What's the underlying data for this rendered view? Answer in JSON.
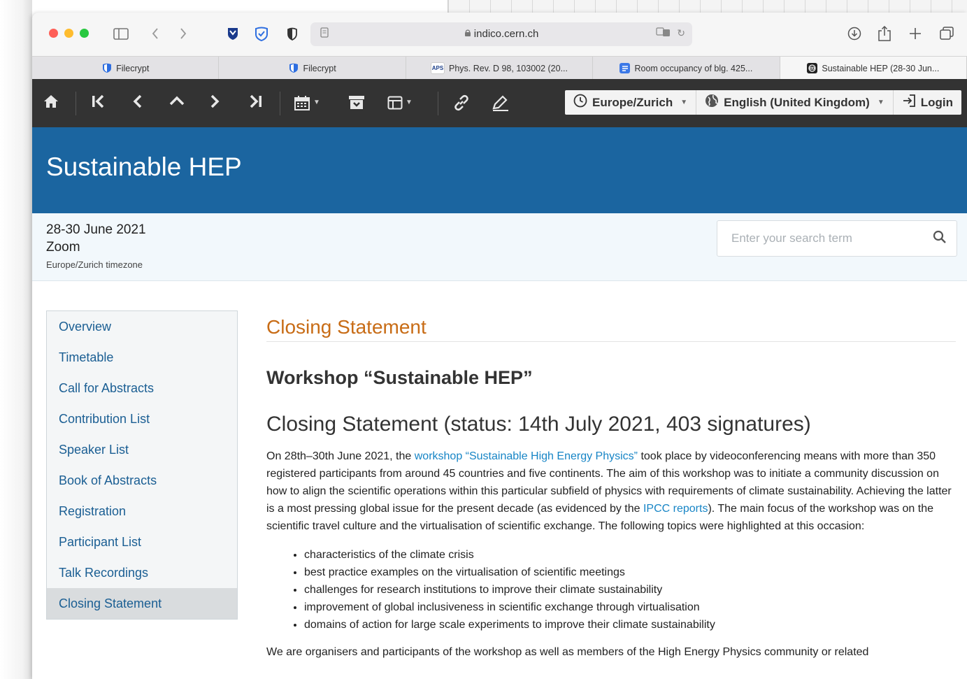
{
  "browser": {
    "url": "indico.cern.ch",
    "tabs": [
      {
        "label": "Filecrypt",
        "active": false,
        "icon": "shield-icon"
      },
      {
        "label": "Filecrypt",
        "active": false,
        "icon": "shield-icon"
      },
      {
        "label": "Phys. Rev. D 98, 103002 (20...",
        "active": false,
        "icon": "aps-icon"
      },
      {
        "label": "Room occupancy of blg. 425...",
        "active": false,
        "icon": "docs-icon"
      },
      {
        "label": "Sustainable HEP (28-30 Jun...",
        "active": true,
        "icon": "indico-icon"
      }
    ]
  },
  "toolbar": {
    "timezone_label": "Europe/Zurich",
    "language_label": "English (United Kingdom)",
    "login_label": "Login"
  },
  "event": {
    "title": "Sustainable HEP",
    "dates": "28-30 June 2021",
    "location": "Zoom",
    "timezone": "Europe/Zurich timezone"
  },
  "search": {
    "placeholder": "Enter your search term"
  },
  "sidebar": {
    "items": [
      {
        "label": "Overview"
      },
      {
        "label": "Timetable"
      },
      {
        "label": "Call for Abstracts"
      },
      {
        "label": "Contribution List"
      },
      {
        "label": "Speaker List"
      },
      {
        "label": "Book of Abstracts"
      },
      {
        "label": "Registration"
      },
      {
        "label": "Participant List"
      },
      {
        "label": "Talk Recordings"
      },
      {
        "label": "Closing Statement"
      }
    ],
    "active_index": 9
  },
  "content": {
    "page_title": "Closing Statement",
    "heading": "Workshop “Sustainable HEP”",
    "subheading": "Closing Statement (status: 14th July 2021, 403 signatures)",
    "para1_a": "On 28th–30th June 2021, the ",
    "para1_link1": "workshop “Sustainable High Energy Physics”",
    "para1_b": " took place by videoconferencing means with more than 350 registered participants from around 45 countries and five continents. The aim of this workshop was to initiate a community discussion on how to align the scientific operations within this particular subfield of physics with requirements of climate sustainability. Achieving the latter is a most pressing global issue for the present decade (as evidenced by the ",
    "para1_link2": "IPCC reports",
    "para1_c": "). The main focus of the workshop was on the scientific travel culture and the virtualisation of scientific exchange. The following topics were highlighted at this occasion:",
    "bullets": [
      "characteristics of the climate crisis",
      "best practice examples on the virtualisation of scientific meetings",
      "challenges for research institutions to improve their climate sustainability",
      "improvement of global inclusiveness in scientific exchange through virtualisation",
      "domains of action for large scale experiments to improve their climate sustainability"
    ],
    "para2": "We are organisers and participants of the workshop as well as members of the High Energy Physics community or related"
  },
  "colors": {
    "header_blue": "#1b65a0",
    "toolbar_dark": "#333333",
    "title_orange": "#c86c16",
    "link_blue": "#1785c6",
    "sidebar_link": "#1a5e93"
  }
}
